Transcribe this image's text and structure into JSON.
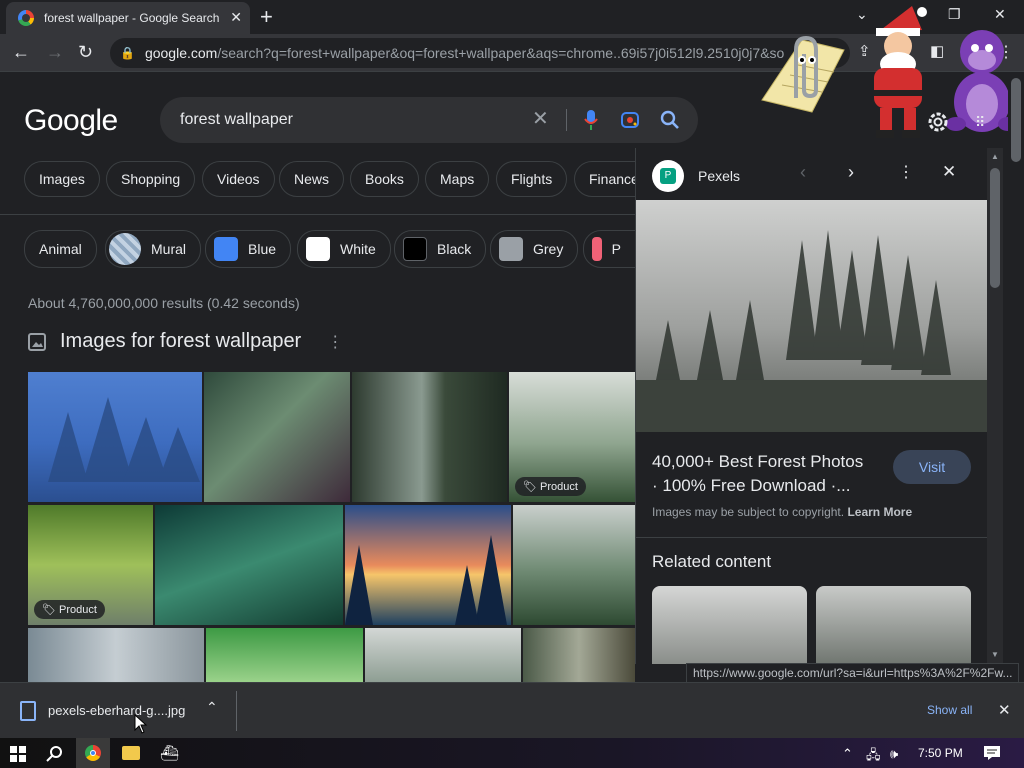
{
  "browser": {
    "tab_title": "forest wallpaper - Google Search",
    "new_tab_label": "+",
    "url_domain": "google.com",
    "url_rest": "/search?q=forest+wallpaper&oq=forest+wallpaper&aqs=chrome..69i57j0i512l9.2510j0j7&so"
  },
  "google": {
    "logo": "Google",
    "query": "forest wallpaper",
    "tabs": [
      "Images",
      "Shopping",
      "Videos",
      "News",
      "Books",
      "Maps",
      "Flights",
      "Finance"
    ],
    "filters": [
      {
        "label": "Animal",
        "color": ""
      },
      {
        "label": "Mural",
        "color": "#b9c8d8"
      },
      {
        "label": "Blue",
        "color": "#4285f4"
      },
      {
        "label": "White",
        "color": "#ffffff"
      },
      {
        "label": "Black",
        "color": "#000000"
      },
      {
        "label": "Grey",
        "color": "#9aa0a6"
      },
      {
        "label": "P",
        "color": "#f06277"
      }
    ],
    "stats": "About 4,760,000,000 results (0.42 seconds)",
    "images_heading": "Images for forest wallpaper",
    "badge_product": "Product"
  },
  "panel": {
    "source": "Pexels",
    "title_line1": "40,000+ Best Forest Photos",
    "title_line2": "· 100% Free Download ·...",
    "visit": "Visit",
    "copyright": "Images may be subject to copyright.",
    "learn_more": "Learn More",
    "related": "Related content"
  },
  "status_url": "https://www.google.com/url?sa=i&url=https%3A%2F%2Fw...",
  "downloads": {
    "file": "pexels-eberhard-g....jpg",
    "show_all": "Show all"
  },
  "taskbar": {
    "time": "7:50 PM"
  }
}
